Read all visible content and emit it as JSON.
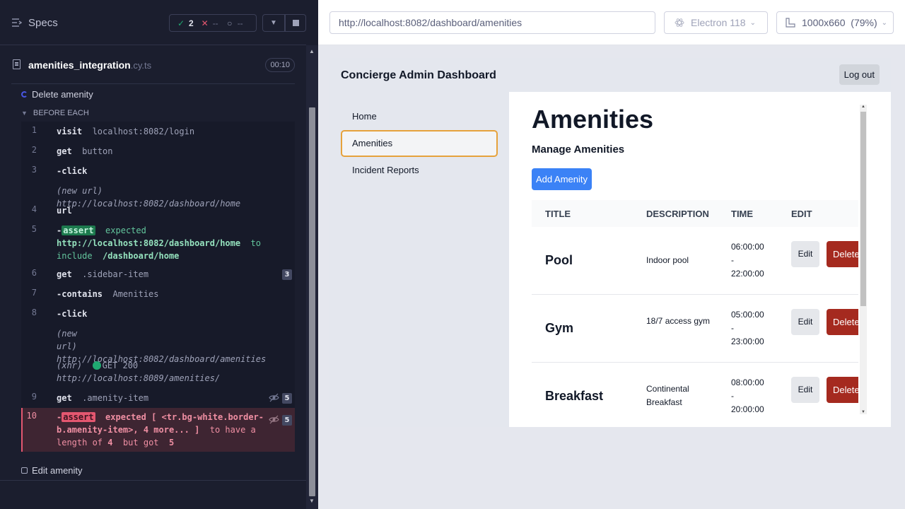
{
  "runner": {
    "specs_label": "Specs",
    "stats": {
      "passed": "2",
      "failed": "--",
      "pending": "--"
    },
    "spec_file": {
      "name": "amenities_integration",
      "ext": ".cy.ts",
      "duration": "00:10"
    },
    "test_1": {
      "title": "Delete amenity",
      "hook": "BEFORE EACH"
    },
    "commands": [
      {
        "num": "1",
        "name": "visit",
        "message": "localhost:8082/login"
      },
      {
        "num": "2",
        "name": "get",
        "message": "button"
      },
      {
        "num": "3",
        "name": "-click",
        "message": "",
        "sub": "(new url)",
        "sub_msg": "http://localhost:8082/dashboard/home"
      },
      {
        "num": "4",
        "name": "url",
        "message": ""
      },
      {
        "num": "5",
        "name": "-",
        "tag": "assert",
        "expected": "expected",
        "value": "http://localhost:8082/dashboard/home",
        "to": "to",
        "include": "include",
        "value2": "/dashboard/home"
      },
      {
        "num": "6",
        "name": "get",
        "message": ".sidebar-item",
        "count": "3"
      },
      {
        "num": "7",
        "name": "-contains",
        "message": "Amenities"
      },
      {
        "num": "8",
        "name": "-click",
        "message": "",
        "sub1": "(new",
        "sub2": "url)",
        "sub_msg": "http://localhost:8082/dashboard/amenities",
        "xhr": "(xhr)",
        "xhr_status": "GET 200",
        "xhr_url": "http://localhost:8089/amenities/"
      },
      {
        "num": "9",
        "name": "get",
        "message": ".amenity-item",
        "count": "5"
      },
      {
        "num": "10",
        "name": "-",
        "tag": "assert",
        "line1": "expected [ <tr.bg-white.border-",
        "line2": "b.amenity-item>, 4 more... ]",
        "to_have": "to have a",
        "line3_a": "length of",
        "n1": "4",
        "but": "but got",
        "n2": "5",
        "count": "5"
      }
    ],
    "test_2": {
      "title": "Edit amenity"
    }
  },
  "topbar": {
    "url": "http://localhost:8082/dashboard/amenities",
    "browser": "Electron 118",
    "viewport": "1000x660",
    "viewport_scale": "(79%)"
  },
  "app": {
    "title": "Concierge Admin Dashboard",
    "logout": "Log out",
    "sidebar": [
      "Home",
      "Amenities",
      "Incident Reports"
    ],
    "active_sidebar": "Amenities",
    "page_title": "Amenities",
    "subtitle": "Manage Amenities",
    "add_button": "Add Amenity",
    "columns": [
      "TITLE",
      "DESCRIPTION",
      "TIME",
      "EDIT"
    ],
    "rows": [
      {
        "title": "Pool",
        "description": "Indoor pool",
        "time_start": "06:00:00",
        "sep": "-",
        "time_end": "22:00:00",
        "edit": "Edit",
        "delete": "Delete"
      },
      {
        "title": "Gym",
        "description": "18/7 access gym",
        "time_start": "05:00:00",
        "sep": "-",
        "time_end": "23:00:00",
        "edit": "Edit",
        "delete": "Delete"
      },
      {
        "title": "Breakfast",
        "description": "Continental Breakfast",
        "time_start": "08:00:00",
        "sep": "-",
        "time_end": "20:00:00",
        "edit": "Edit",
        "delete": "Delete"
      }
    ]
  }
}
